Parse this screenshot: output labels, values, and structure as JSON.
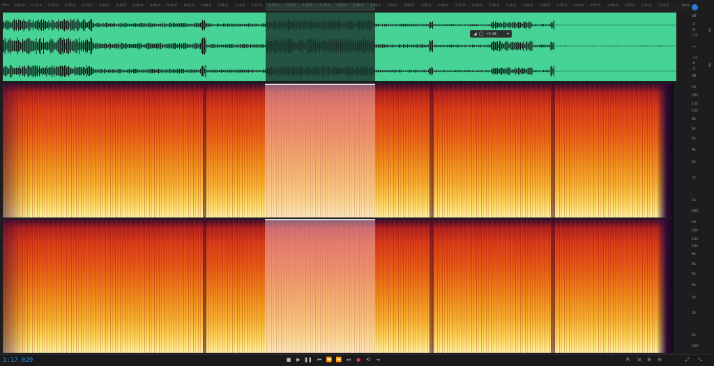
{
  "timeline": {
    "unit_label": "hms",
    "ticks": [
      "0:05.0",
      "0:10.0",
      "0:15.0",
      "0:20.0",
      "0:25.0",
      "0:30.0",
      "0:35.0",
      "0:40.0",
      "0:45.0",
      "0:50.0",
      "0:55.0",
      "1:00.0",
      "1:05.0",
      "1:10.0",
      "1:15.0",
      "1:20.0",
      "1:25.0",
      "1:30.0",
      "1:35.0",
      "1:40.0",
      "1:45.0",
      "1:50.0",
      "1:55.0",
      "2:00.0",
      "2:05.0",
      "2:10.0",
      "2:15.0",
      "2:20.0",
      "2:25.0",
      "2:30.0",
      "2:35.0",
      "2:40.0",
      "2:45.0",
      "2:50.0",
      "2:55.0",
      "3:00.0",
      "3:05.0",
      "3:10.0",
      "3:15.0"
    ]
  },
  "waveform": {
    "hud_value": "+0 dB",
    "db_labels": [
      "dB",
      "-3",
      "-6",
      "-12",
      "-∞",
      "-12",
      "-6",
      "-3",
      "dB"
    ],
    "color": "#46d395",
    "selection_color": "#1c382e"
  },
  "spectrogram": {
    "hz_labels": [
      "Hz",
      "20k",
      "15k",
      "10k",
      "8k",
      "6k",
      "5k",
      "4k",
      "3k",
      "2k",
      "1k",
      "500"
    ],
    "hz_labels_b": [
      "Hz",
      "20k",
      "15k",
      "10k",
      "8k",
      "6k",
      "5k",
      "4k",
      "3k",
      "2k",
      "1k",
      "500"
    ]
  },
  "transport": {
    "time": "1:17.029",
    "buttons": [
      "stop",
      "play",
      "pause",
      "go-to-start",
      "rewind",
      "fast-forward",
      "go-to-end",
      "record",
      "loop",
      "skip-selection"
    ]
  },
  "right_tools": [
    "zoom-in-amplitude",
    "zoom-out-amplitude",
    "zoom-in-time",
    "zoom-out-time",
    "zoom-selection",
    "zoom-full"
  ],
  "colors": {
    "accent": "#2f86d8",
    "record": "#e03434",
    "waveform": "#46d395"
  }
}
